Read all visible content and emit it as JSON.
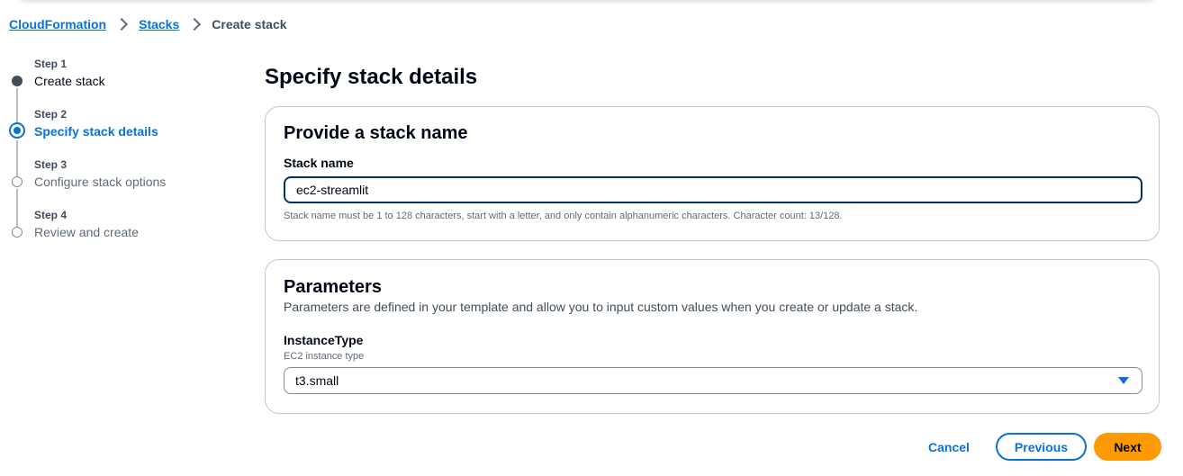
{
  "breadcrumb": {
    "items": [
      {
        "label": "CloudFormation"
      },
      {
        "label": "Stacks"
      },
      {
        "label": "Create stack"
      }
    ]
  },
  "wizard": {
    "steps": [
      {
        "number": "Step 1",
        "label": "Create stack",
        "state": "completed"
      },
      {
        "number": "Step 2",
        "label": "Specify stack details",
        "state": "active"
      },
      {
        "number": "Step 3",
        "label": "Configure stack options",
        "state": "upcoming"
      },
      {
        "number": "Step 4",
        "label": "Review and create",
        "state": "upcoming"
      }
    ]
  },
  "page": {
    "title": "Specify stack details"
  },
  "stack_name_panel": {
    "title": "Provide a stack name",
    "field_label": "Stack name",
    "value": "ec2-streamlit",
    "constraint": "Stack name must be 1 to 128 characters, start with a letter, and only contain alphanumeric characters. Character count: 13/128."
  },
  "parameters_panel": {
    "title": "Parameters",
    "description": "Parameters are defined in your template and allow you to input custom values when you create or update a stack.",
    "instance_type": {
      "label": "InstanceType",
      "description": "EC2 instance type",
      "selected": "t3.small"
    }
  },
  "footer": {
    "cancel_label": "Cancel",
    "previous_label": "Previous",
    "next_label": "Next"
  },
  "colors": {
    "link": "#0972d3",
    "primary_button": "#ff9900",
    "text": "#000716",
    "muted": "#5f6b7a"
  }
}
